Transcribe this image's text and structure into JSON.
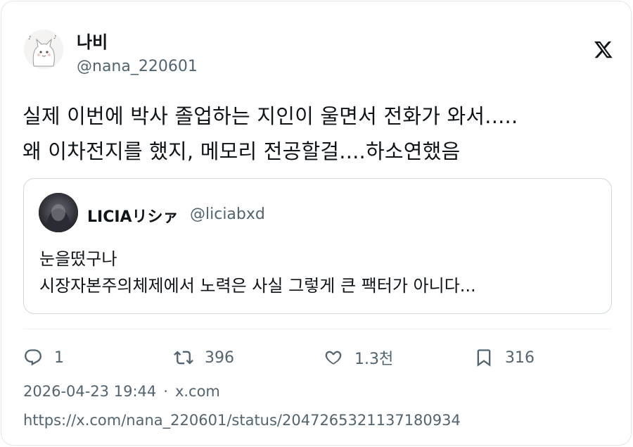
{
  "author": {
    "display_name": "나비",
    "handle": "@nana_220601",
    "avatar_icon": "white-cat-avatar"
  },
  "brand_icon": "x-logo-icon",
  "tweet": {
    "lines": [
      "실제 이번에 박사 졸업하는 지인이 울면서 전화가 와서.....",
      "왜 이차전지를 했지, 메모리 전공할걸....하소연했음"
    ]
  },
  "quoted": {
    "display_name": "LICIAリシァ",
    "handle": "@liciabxd",
    "lines": [
      "눈을떴구나",
      "시장자본주의체제에서 노력은 사실 그렇게 큰 팩터가 아니다..."
    ]
  },
  "actions": {
    "reply": {
      "icon": "reply-icon",
      "count": "1"
    },
    "retweet": {
      "icon": "retweet-icon",
      "count": "396"
    },
    "like": {
      "icon": "heart-icon",
      "count": "1.3천"
    },
    "bookmark": {
      "icon": "bookmark-icon",
      "count": "316"
    }
  },
  "meta": {
    "timestamp": "2026-04-23 19:44",
    "separator": "·",
    "source": "x.com",
    "url": "https://x.com/nana_220601/status/2047265321137180934"
  },
  "colors": {
    "text": "#0f1419",
    "secondary": "#536471",
    "border": "#cfd9de"
  }
}
